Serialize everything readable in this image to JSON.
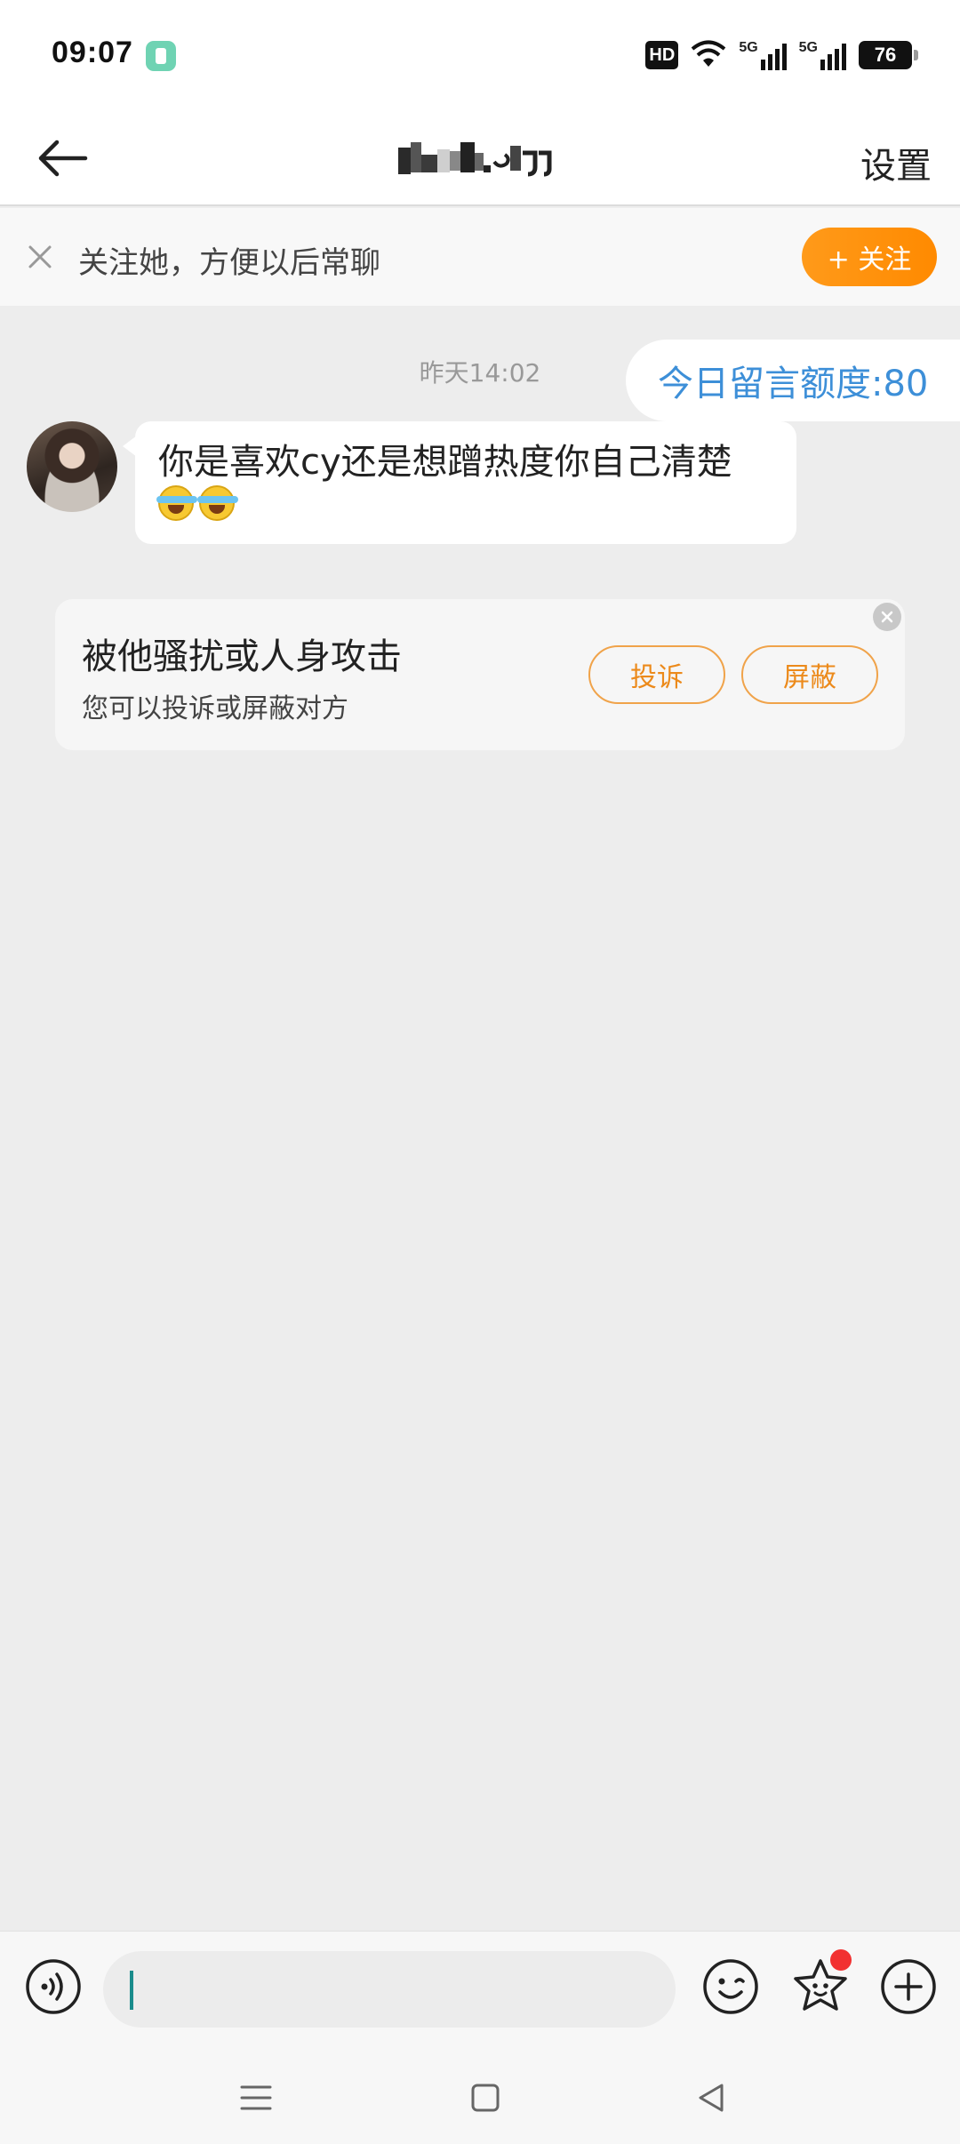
{
  "status_bar": {
    "time": "09:07",
    "network_badge": "HD",
    "signal_1": "5G",
    "signal_2": "5G",
    "battery": "76",
    "icons": [
      "app-notification-icon",
      "hd-icon",
      "wifi-icon",
      "signal-5g-icon",
      "signal-5g-icon",
      "battery-icon"
    ]
  },
  "header": {
    "back_icon": "arrow-left-icon",
    "title_obscured": true,
    "settings_label": "设置"
  },
  "follow_banner": {
    "close_icon": "close-icon",
    "text": "关注她，方便以后常聊",
    "follow_button_label": "+ 关注",
    "accent": "#ff9000"
  },
  "chat": {
    "timestamp": "昨天14:02",
    "quota_label": "今日留言额度:80",
    "incoming_message": {
      "text": "你是喜欢cy还是想蹭热度你自己清楚",
      "emoji": [
        "laugh-cry-emoji",
        "laugh-cry-emoji"
      ]
    }
  },
  "report_card": {
    "title": "被他骚扰或人身攻击",
    "subtitle": "您可以投诉或屏蔽对方",
    "complain_label": "投诉",
    "block_label": "屏蔽",
    "button_color": "#ec8a1b"
  },
  "input_bar": {
    "placeholder": "",
    "icons": [
      "voice-icon",
      "emoji-icon",
      "sticker-icon",
      "plus-icon"
    ]
  },
  "nav_bar": {
    "icons": [
      "menu-icon",
      "home-icon",
      "back-triangle-icon"
    ]
  }
}
